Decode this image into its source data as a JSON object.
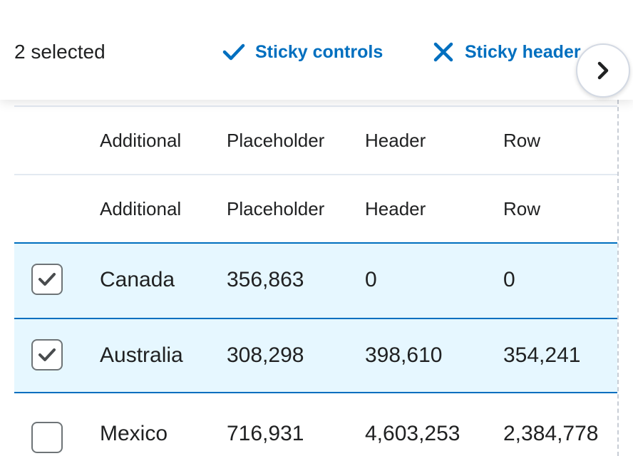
{
  "controls": {
    "selected_count": "2 selected",
    "sticky_controls_label": "Sticky controls",
    "sticky_header_label": "Sticky header",
    "sticky_controls_icon": "check-icon",
    "sticky_header_icon": "close-icon",
    "scroll_right_icon": "chevron-right-icon"
  },
  "table": {
    "header_rows": [
      [
        "Additional",
        "Placeholder",
        "Header",
        "Row"
      ],
      [
        "Additional",
        "Placeholder",
        "Header",
        "Row"
      ]
    ],
    "rows": [
      {
        "selected": true,
        "cells": [
          "Canada",
          "356,863",
          "0",
          "0"
        ]
      },
      {
        "selected": true,
        "cells": [
          "Australia",
          "308,298",
          "398,610",
          "354,241"
        ]
      },
      {
        "selected": false,
        "cells": [
          "Mexico",
          "716,931",
          "4,603,253",
          "2,384,778"
        ]
      }
    ]
  },
  "colors": {
    "accent": "#006fbf",
    "selected_row_bg": "#e6f7ff",
    "text": "#202122",
    "border": "#e3e9f1"
  }
}
